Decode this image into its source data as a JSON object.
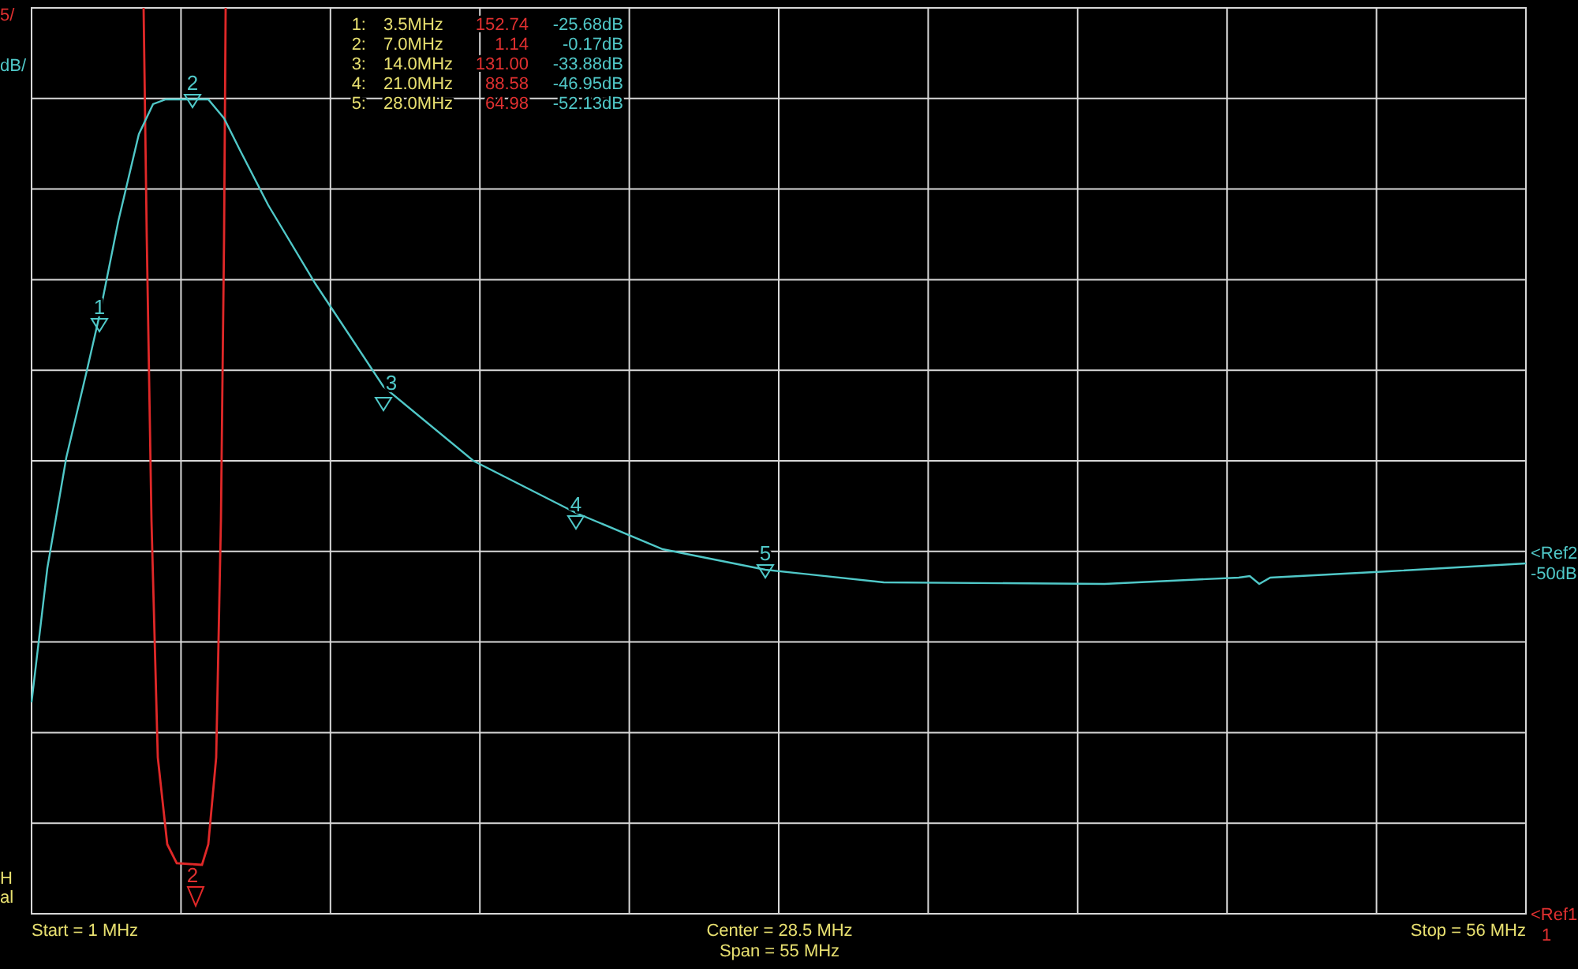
{
  "scale_labels": {
    "trace_1": "5/",
    "trace_2": "dB/"
  },
  "left_bottom_labels": [
    "H",
    "al"
  ],
  "marker_table": [
    {
      "number": "1:",
      "frequency": "3.5MHz",
      "trace_1_value": "152.74",
      "trace_2_value": "-25.68dB"
    },
    {
      "number": "2:",
      "frequency": "7.0MHz",
      "trace_1_value": "1.14",
      "trace_2_value": "-0.17dB"
    },
    {
      "number": "3:",
      "frequency": "14.0MHz",
      "trace_1_value": "131.00",
      "trace_2_value": "-33.88dB"
    },
    {
      "number": "4:",
      "frequency": "21.0MHz",
      "trace_1_value": "88.58",
      "trace_2_value": "-46.95dB"
    },
    {
      "number": "5:",
      "frequency": "28.0MHz",
      "trace_1_value": "64.98",
      "trace_2_value": "-52.13dB"
    }
  ],
  "trace_2_markers": [
    "1",
    "2",
    "3",
    "4",
    "5"
  ],
  "trace_1_markers": [
    "2"
  ],
  "ref_2": {
    "label": "<Ref2",
    "value": "-50dB"
  },
  "ref_1": {
    "label": "<Ref1",
    "value": "1"
  },
  "footer": {
    "start": "Start = 1 MHz",
    "center": "Center = 28.5 MHz",
    "span": "Span = 55 MHz",
    "stop": "Stop = 56 MHz"
  }
}
